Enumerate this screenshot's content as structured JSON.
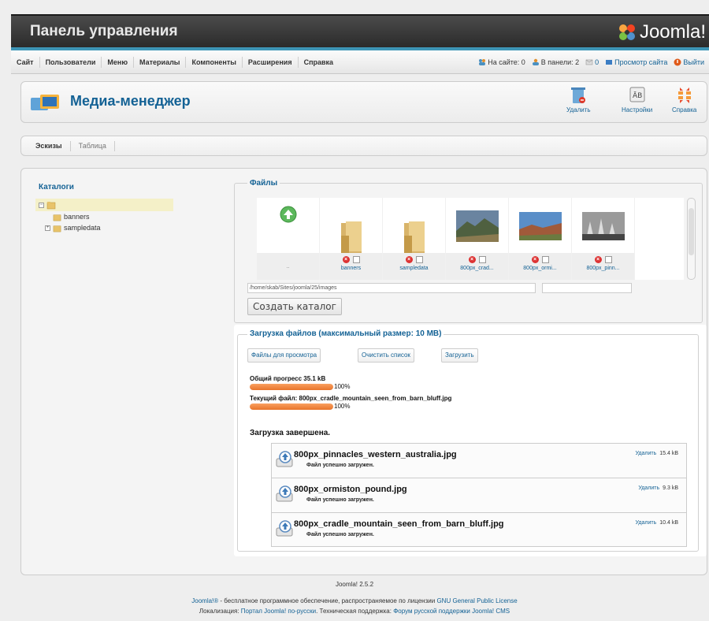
{
  "header": {
    "title": "Панель управления",
    "logo_text": "Joomla!"
  },
  "menu": {
    "items": [
      "Сайт",
      "Пользователи",
      "Меню",
      "Материалы",
      "Компоненты",
      "Расширения",
      "Справка"
    ],
    "status": {
      "on_site": "На сайте: 0",
      "in_panel": "В панели: 2",
      "messages": "0",
      "view_site": "Просмотр сайта",
      "logout": "Выйти"
    }
  },
  "toolbar": {
    "title": "Медиа-менеджер",
    "delete_label": "Удалить",
    "settings_label": "Настройки",
    "help_label": "Справка"
  },
  "subnav": {
    "tabs": [
      "Эскизы",
      "Таблица"
    ]
  },
  "folders": {
    "legend": "Каталоги",
    "children": [
      "banners",
      "sampledata"
    ]
  },
  "files": {
    "legend": "Файлы",
    "up_label": "..",
    "items": [
      {
        "name": "banners",
        "type": "folder"
      },
      {
        "name": "sampledata",
        "type": "folder"
      },
      {
        "name": "800px_crad...",
        "type": "image"
      },
      {
        "name": "800px_ormi...",
        "type": "image"
      },
      {
        "name": "800px_pinn...",
        "type": "image"
      }
    ],
    "path": "/home/skab/Sites/joomla/25/images",
    "create_folder": "Создать каталог"
  },
  "upload": {
    "legend": "Загрузка файлов (максимальный размер: 10 MB)",
    "browse_label": "Файлы для просмотра",
    "clear_label": "Очистить список",
    "upload_label": "Загрузить",
    "overall_label": "Общий прогресс 35.1 kB",
    "overall_progress": 1.0,
    "overall_pct": "100%",
    "current_label": "Текущий файл: 800px_cradle_mountain_seen_from_barn_bluff.jpg",
    "current_progress": 1.0,
    "current_pct": "100%",
    "complete": "Загрузка завершена.",
    "files": [
      {
        "name": "800px_pinnacles_western_australia.jpg",
        "status": "Файл успешно загружен.",
        "remove": "Удалить",
        "size": "15.4 kB"
      },
      {
        "name": "800px_ormiston_pound.jpg",
        "status": "Файл успешно загружен.",
        "remove": "Удалить",
        "size": "9.3 kB"
      },
      {
        "name": "800px_cradle_mountain_seen_from_barn_bluff.jpg",
        "status": "Файл успешно загружен.",
        "remove": "Удалить",
        "size": "10.4 kB"
      }
    ]
  },
  "footer": {
    "version": "Joomla! 2.5.2",
    "line1_brand": "Joomla!®",
    "line1_text": " - бесплатное программное обеспечение, распространяемое по лицензии ",
    "line1_link": "GNU General Public License",
    "line2_prefix": "Локализация: ",
    "line2_link1": "Портал Joomla! по-русски",
    "line2_mid": ". Техническая поддержка: ",
    "line2_link2": "Форум русской поддержки Joomla! CMS"
  },
  "colors": {
    "accent": "#146295",
    "progress": "#f08a44",
    "menu_border": "#3d95b6"
  }
}
